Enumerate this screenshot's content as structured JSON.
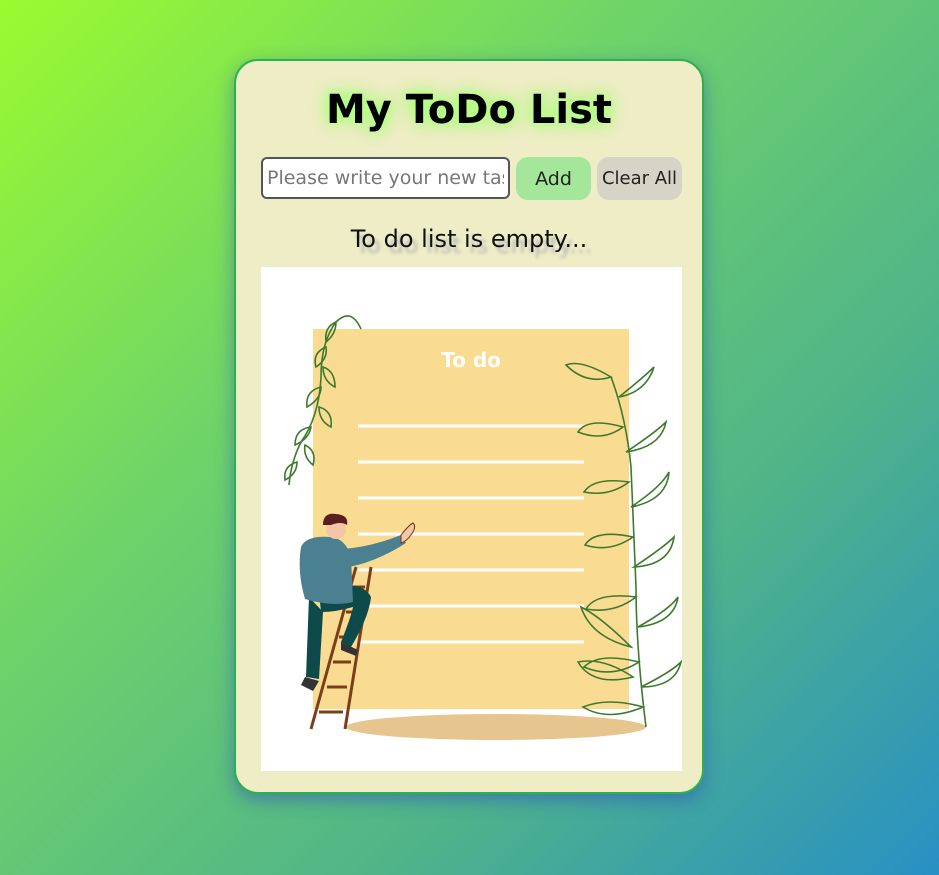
{
  "app": {
    "title": "My ToDo List"
  },
  "form": {
    "input_placeholder": "Please write your new task",
    "input_value": "",
    "add_label": "Add",
    "clear_label": "Clear All"
  },
  "list": {
    "empty_message": "To do list is empty..."
  },
  "illustration": {
    "board_text": "To do"
  },
  "colors": {
    "accent_green": "#2bb24c",
    "card_bg": "#efedc6",
    "add_button": "#a5e79a",
    "clear_button": "#d6d4c6",
    "board": "#fadb92"
  }
}
